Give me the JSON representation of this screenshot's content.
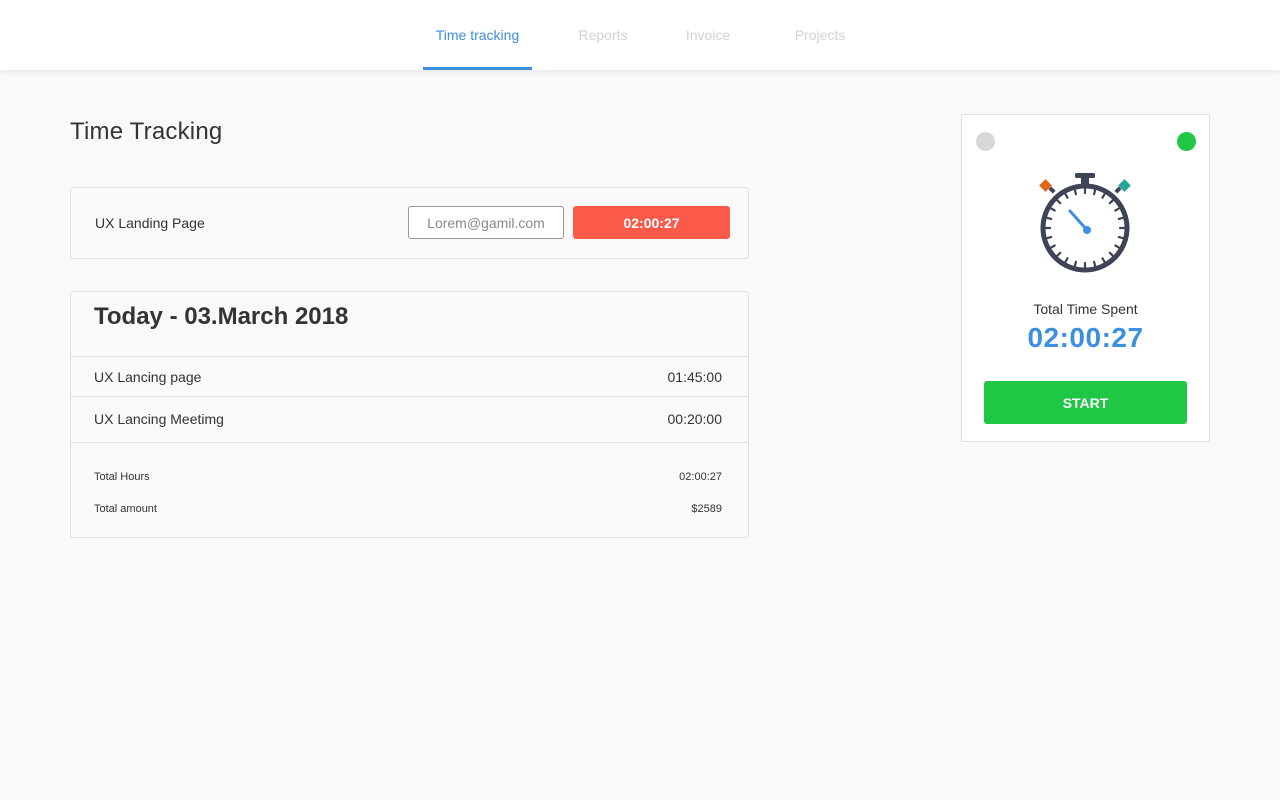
{
  "nav": {
    "tabs": [
      {
        "label": "Time tracking",
        "active": true
      },
      {
        "label": "Reports",
        "active": false
      },
      {
        "label": "Invoice",
        "active": false
      },
      {
        "label": "Projects",
        "active": false
      }
    ]
  },
  "page": {
    "title": "Time Tracking"
  },
  "current_task": {
    "name": "UX Landing Page",
    "email_placeholder": "Lorem@gamil.com",
    "timer": "02:00:27"
  },
  "log": {
    "title": "Today - 03.March 2018",
    "entries": [
      {
        "name": "UX Lancing page",
        "time": "01:45:00"
      },
      {
        "name": "UX Lancing Meetimg",
        "time": "00:20:00"
      }
    ],
    "summary": [
      {
        "label": "Total Hours",
        "value": "02:00:27"
      },
      {
        "label": "Total amount",
        "value": "$2589"
      }
    ]
  },
  "widget": {
    "total_label": "Total Time Spent",
    "total_time": "02:00:27",
    "start_label": "START",
    "icon": "stopwatch-icon"
  },
  "colors": {
    "accent_blue": "#3d8fe0",
    "timer_red": "#fb5a4b",
    "start_green": "#1fc744",
    "status_gray": "#d8d8d8"
  }
}
